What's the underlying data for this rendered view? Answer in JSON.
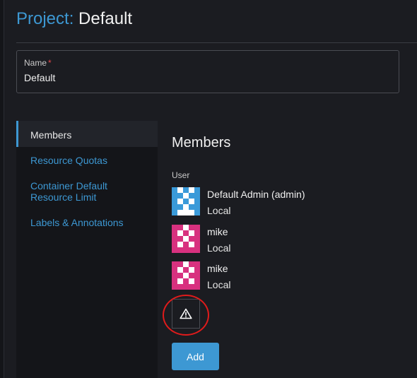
{
  "header": {
    "prefix": "Project:",
    "name": "Default"
  },
  "form": {
    "name_label": "Name",
    "required_mark": "*",
    "name_value": "Default"
  },
  "tabs": [
    {
      "label": "Members",
      "active": true
    },
    {
      "label": "Resource Quotas",
      "active": false
    },
    {
      "label": "Container Default Resource Limit",
      "active": false
    },
    {
      "label": "Labels & Annotations",
      "active": false
    }
  ],
  "members_section": {
    "title": "Members",
    "column_label": "User",
    "members": [
      {
        "name": "Default Admin (admin)",
        "provider": "Local",
        "avatar_color": "#3a9ad9"
      },
      {
        "name": "mike",
        "provider": "Local",
        "avatar_color": "#d8317f"
      },
      {
        "name": "mike",
        "provider": "Local",
        "avatar_color": "#d8317f"
      }
    ],
    "warning_icon": "warning-triangle-icon",
    "add_label": "Add"
  },
  "colors": {
    "accent": "#3d98d3",
    "annotation_circle": "#e01b1b",
    "background": "#1b1c21"
  }
}
